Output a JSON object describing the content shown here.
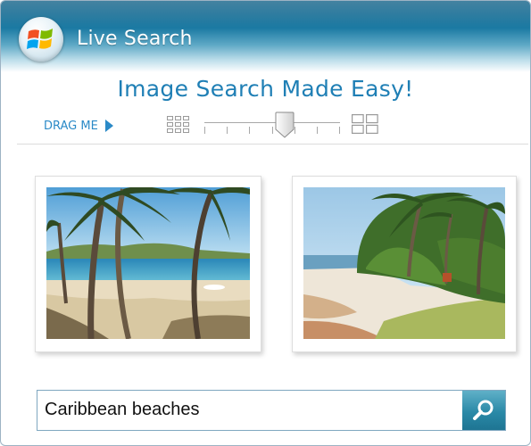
{
  "app": {
    "title": "Live Search",
    "logo_icon": "windows-flag-icon"
  },
  "tagline": "Image Search Made Easy!",
  "zoom": {
    "drag_label": "DRAG ME",
    "drag_icon": "play-arrow-icon",
    "min_icon": "small-thumbnail-grid-icon",
    "max_icon": "large-thumbnail-grid-icon",
    "tick_count": 7,
    "value": 0.59
  },
  "results": [
    {
      "name": "result-palm-beach",
      "scene": "palm trees on sandy beach with turquoise water"
    },
    {
      "name": "result-jungle-beach",
      "scene": "beach path lined with tropical vegetation"
    }
  ],
  "search": {
    "query": "Caribbean beaches",
    "button_icon": "magnifier-icon"
  },
  "colors": {
    "accent": "#1f7fb5",
    "header_dark": "#0f5f86",
    "link": "#2b8ac7",
    "search_button": "#2a89a7"
  }
}
